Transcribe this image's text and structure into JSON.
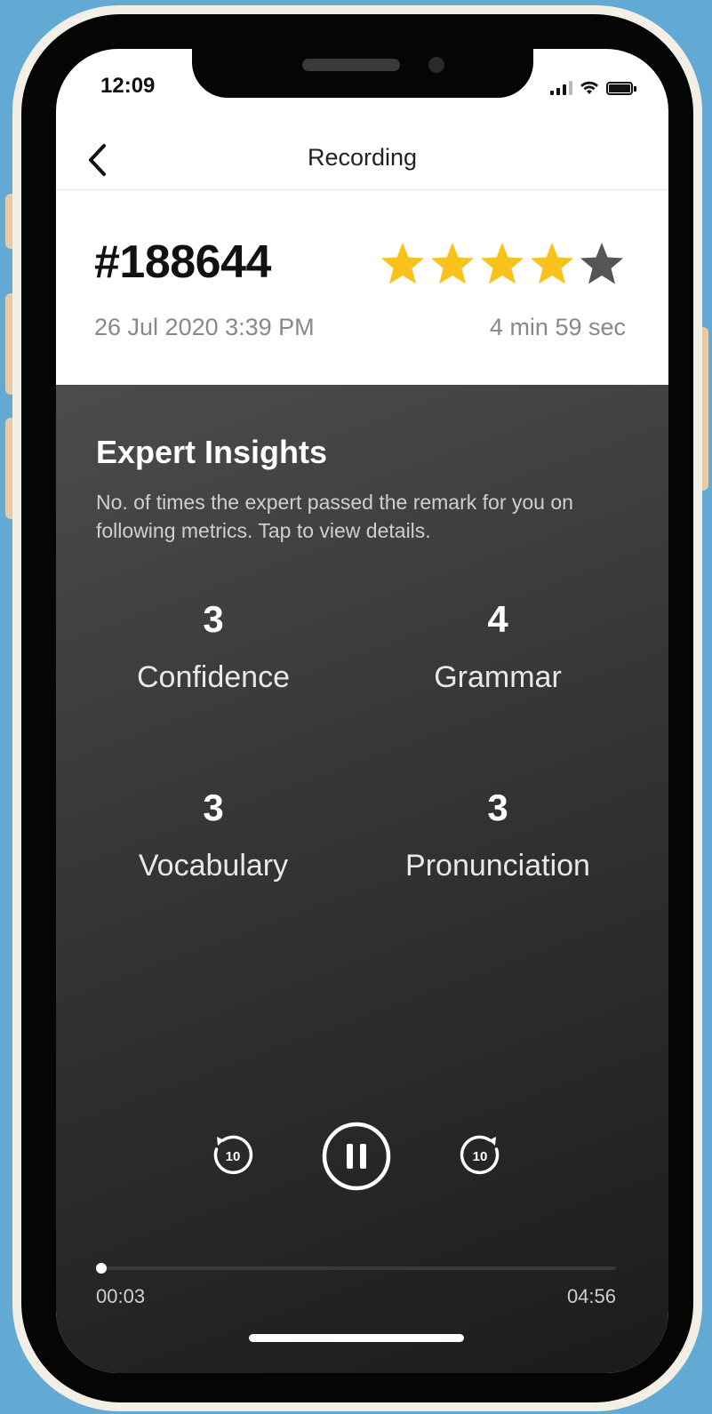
{
  "status_bar": {
    "time": "12:09"
  },
  "nav": {
    "title": "Recording"
  },
  "recording": {
    "id": "#188644",
    "rating": 4,
    "rating_max": 5,
    "date": "26 Jul 2020 3:39 PM",
    "duration": "4 min 59 sec"
  },
  "insights": {
    "title": "Expert Insights",
    "description": "No. of times the expert passed the remark for you on following metrics. Tap to view details.",
    "metrics": [
      {
        "count": "3",
        "label": "Confidence"
      },
      {
        "count": "4",
        "label": "Grammar"
      },
      {
        "count": "3",
        "label": "Vocabulary"
      },
      {
        "count": "3",
        "label": "Pronunciation"
      }
    ]
  },
  "player": {
    "rewind_seconds": "10",
    "forward_seconds": "10",
    "current_time": "00:03",
    "total_time": "04:56",
    "progress": 0.01
  },
  "colors": {
    "background": "#62a9d3",
    "star_filled": "#f7c21b",
    "star_empty": "#555555",
    "panel_dark": "#2b2b2b"
  }
}
